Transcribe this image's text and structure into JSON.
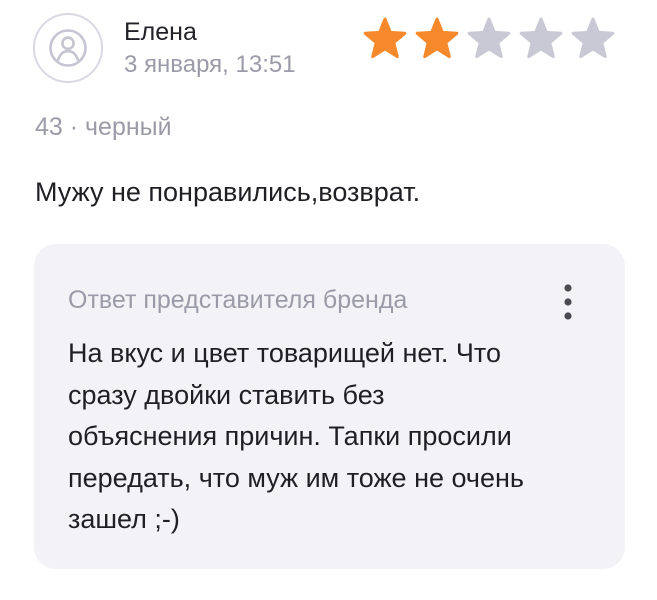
{
  "review": {
    "author": "Елена",
    "date": "3 января, 13:51",
    "rating": 2,
    "max_rating": 5,
    "variant": "43 · черный",
    "text": "Мужу не понравились,возврат."
  },
  "brand_reply": {
    "title": "Ответ представителя бренда",
    "text": "На вкус и цвет товарищей нет. Что\nсразу двойки ставить без\nобъяснения причин. Тапки просили\nпередать, что муж им тоже не очень\nзашел ;-)"
  },
  "icons": {
    "avatar": "user-icon",
    "star": "star-icon",
    "menu": "kebab-menu-icon"
  },
  "colors": {
    "star_filled": "#f5892b",
    "star_empty": "#c9c9d6",
    "muted_text": "#9b9ba8",
    "reply_background": "#f3f2f7"
  }
}
